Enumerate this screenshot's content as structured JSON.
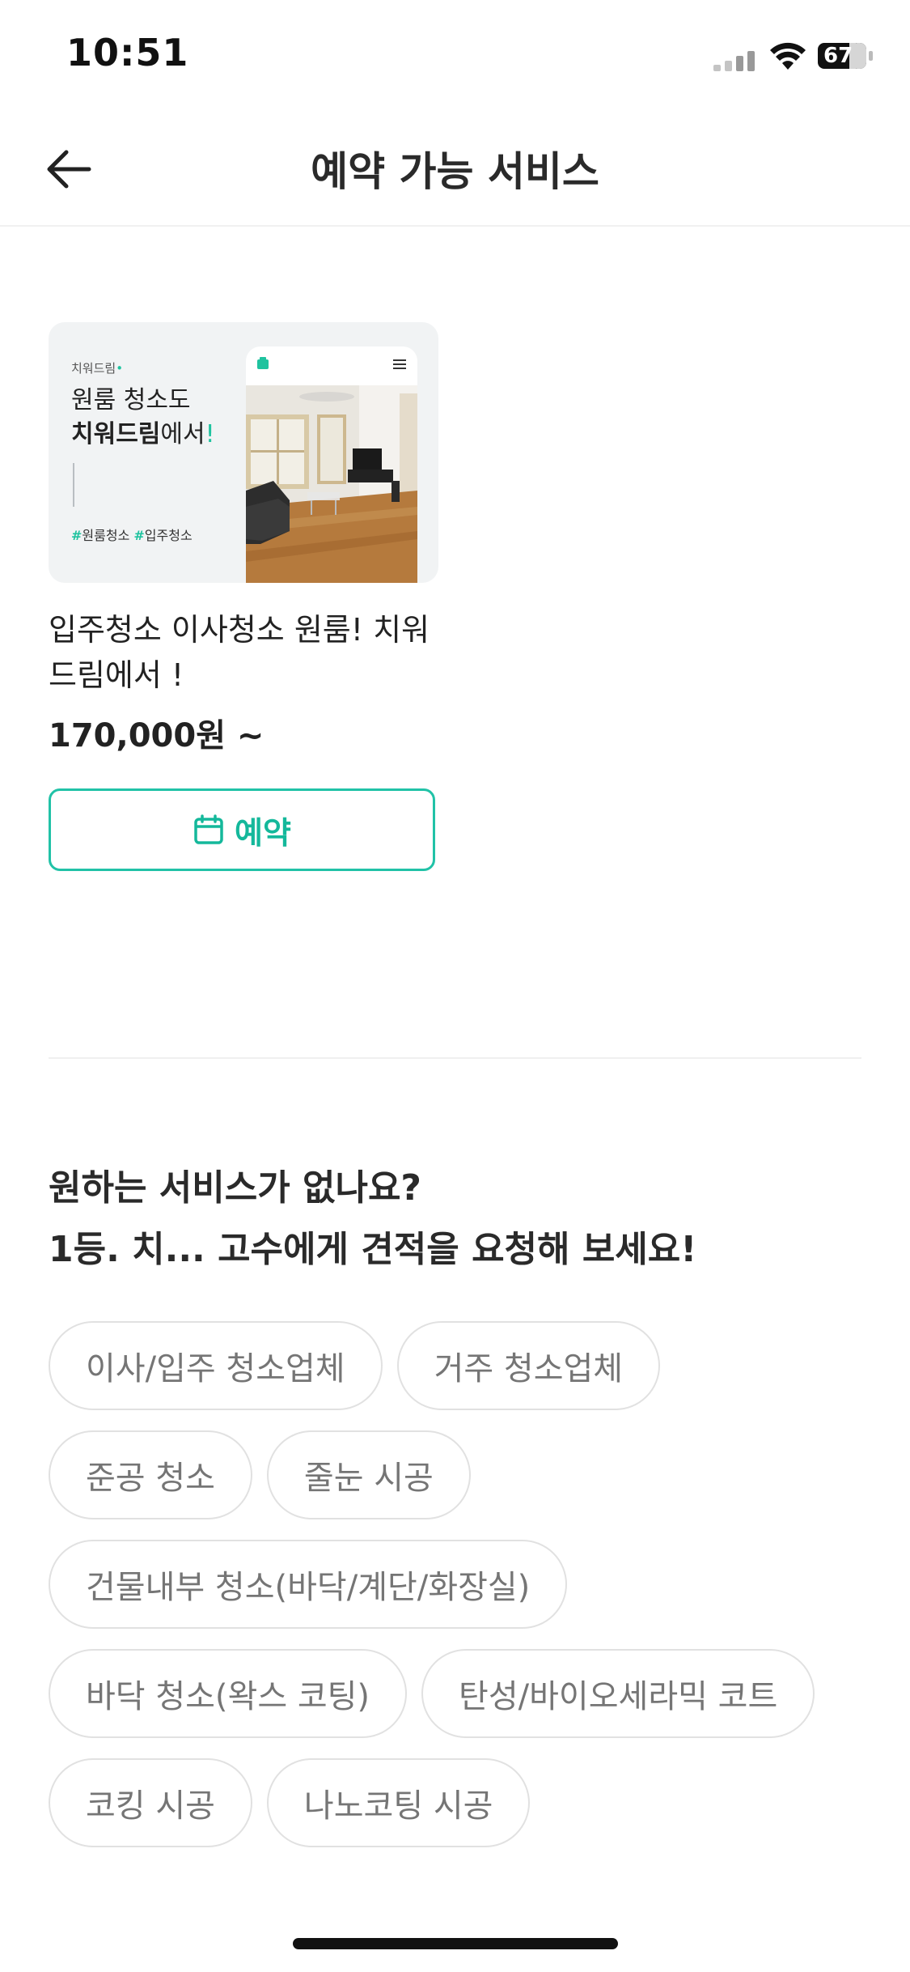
{
  "status_bar": {
    "time": "10:51",
    "battery_level": "67",
    "icons": [
      "signal-icon",
      "wifi-icon",
      "battery-icon"
    ]
  },
  "header": {
    "title": "예약 가능 서비스",
    "back_icon": "arrow-left-icon"
  },
  "service": {
    "thumbnail": {
      "brand": "치워드림",
      "headline_line1": "원룸 청소도",
      "headline_bold": "치워드림",
      "headline_suffix": "에서",
      "headline_mark": "!",
      "tag1_hash": "#",
      "tag1": "원룸청소",
      "tag2_hash": "#",
      "tag2": "입주청소"
    },
    "title": "입주청소 이사청소 원룸! 치워드림에서 !",
    "price": "170,000원 ~",
    "reserve_label": "예약",
    "reserve_icon": "calendar-icon"
  },
  "request": {
    "line1": "원하는 서비스가 없나요?",
    "line2": "1등. 치... 고수에게 견적을 요청해 보세요!"
  },
  "categories": {
    "row1": [
      "이사/입주 청소업체",
      "거주 청소업체"
    ],
    "row2": [
      "준공 청소",
      "줄눈 시공"
    ],
    "row3": [
      "건물내부 청소(바닥/계단/화장실)"
    ],
    "row4": [
      "바닥 청소(왁스 코팅)",
      "탄성/바이오세라믹 코트"
    ],
    "row5": [
      "코킹 시공",
      "나노코팅 시공"
    ]
  },
  "colors": {
    "accent": "#21c2a7",
    "text": "#222222",
    "chip_text": "#757575",
    "chip_border": "#e1e1e1"
  }
}
